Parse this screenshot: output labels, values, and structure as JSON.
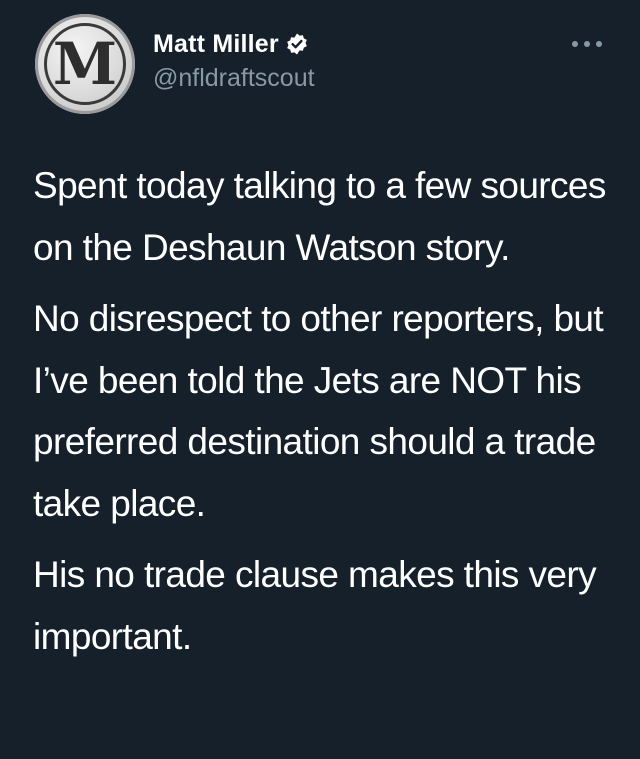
{
  "author": {
    "display_name": "Matt Miller",
    "handle": "@nfldraftscout",
    "avatar_letter": "M",
    "verified": true
  },
  "tweet": {
    "paragraphs": [
      "Spent today talking to a few sources on the Deshaun Watson story.",
      "No disrespect to other reporters, but I’ve been told the Jets are NOT his preferred destination should a trade take place.",
      "His no trade clause makes this very important."
    ]
  },
  "colors": {
    "background": "#15202b",
    "text": "#ffffff",
    "secondary_text": "#8899a6",
    "verified_badge": "#ffffff"
  },
  "icons": {
    "verified": "verified-badge-icon",
    "more": "more-dots-icon"
  }
}
